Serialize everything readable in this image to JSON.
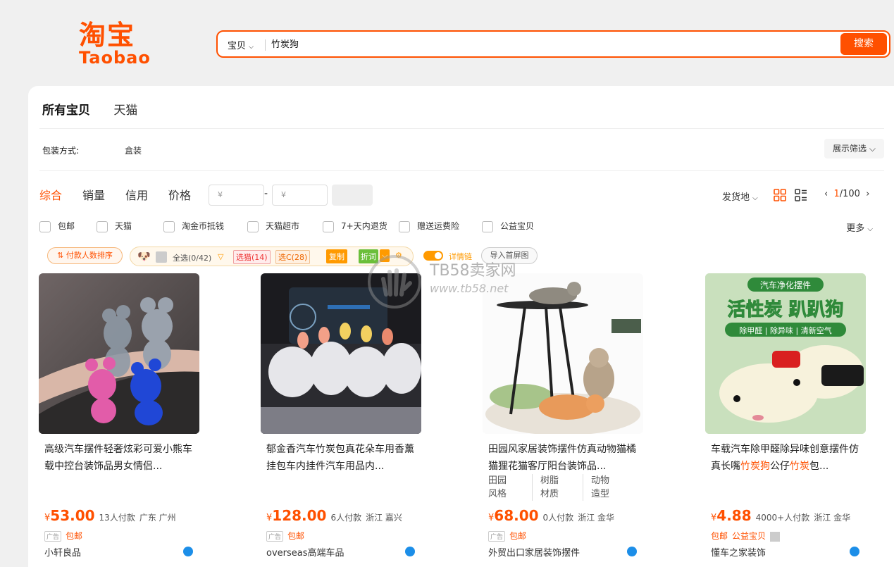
{
  "logo": {
    "cn": "淘宝",
    "en": "Taobao"
  },
  "search": {
    "scope": "宝贝",
    "query": "竹炭狗",
    "button": "搜索"
  },
  "tabs": [
    "所有宝贝",
    "天猫"
  ],
  "pack": {
    "label": "包装方式:",
    "value": "盒装",
    "filter_button": "展示筛选"
  },
  "sort": {
    "items": [
      "综合",
      "销量",
      "信用",
      "价格"
    ],
    "price_min_placeholder": "¥",
    "price_max_placeholder": "¥",
    "dash": "-",
    "ship_from": "发货地"
  },
  "pager": {
    "current": "1",
    "total": "/100"
  },
  "checkboxes": [
    "包邮",
    "天猫",
    "淘金币抵钱",
    "天猫超市",
    "7+天内退货",
    "赠送运费险",
    "公益宝贝"
  ],
  "more": "更多",
  "toolbar": {
    "sort_pay": "付款人数排序",
    "select_all": "全选(0/42)",
    "sel_tmall": "选猫(14)",
    "sel_c": "选C(28)",
    "copy": "复制",
    "discount": "折词",
    "detail_toggle": "详情链",
    "import": "导入首屏图"
  },
  "watermark": {
    "title": "TB58卖家网",
    "url": "www.tb58.net"
  },
  "products": [
    {
      "title": "高级汽车摆件轻奢炫彩可爱小熊车载中控台装饰品男女情侣...",
      "price": "53.00",
      "sold": "13人付款",
      "location": "广东 广州",
      "tags": [
        "包邮"
      ],
      "ad": "广告",
      "shop": "小轩良品"
    },
    {
      "title": "郁金香汽车竹炭包真花朵车用香薰挂包车内挂件汽车用品内...",
      "price": "128.00",
      "sold": "6人付款",
      "location": "浙江 嘉兴",
      "tags": [
        "包邮"
      ],
      "ad": "广告",
      "shop": "overseas高端车品"
    },
    {
      "title": "田园风家居装饰摆件仿真动物猫橘猫狸花猫客厅阳台装饰品...",
      "attrs": [
        [
          "田园",
          "风格"
        ],
        [
          "树脂",
          "材质"
        ],
        [
          "动物",
          "造型"
        ]
      ],
      "price": "68.00",
      "sold": "0人付款",
      "location": "浙江 金华",
      "tags": [
        "包邮"
      ],
      "ad": "广告",
      "shop": "外贸出口家居装饰摆件"
    },
    {
      "title_pre": "车载汽车除甲醛除异味创意摆件仿真长嘴",
      "title_hl1": "竹炭狗",
      "title_mid": "公仔",
      "title_hl2": "竹炭",
      "title_post": "包...",
      "price": "4.88",
      "sold": "4000+人付款",
      "location": "浙江 金华",
      "tags": [
        "包邮",
        "公益宝贝"
      ],
      "shop": "懂车之家装饰",
      "image_text": {
        "banner": "汽车净化摆件",
        "headline": "活性炭 趴趴狗",
        "sub": "除甲醛 | 除异味 | 清新空气"
      }
    }
  ],
  "colors": {
    "accent": "#ff5000",
    "link": "#1c8ee8"
  }
}
